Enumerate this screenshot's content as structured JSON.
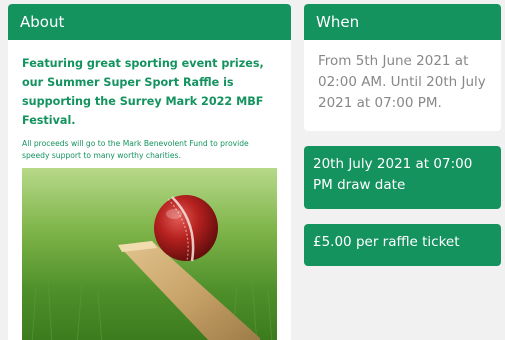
{
  "about": {
    "title": "About",
    "lead": "Featuring great sporting event prizes, our Summer Super Sport Raffle is supporting the Surrey Mark 2022 MBF Festival.",
    "detail": "All proceeds will go to the Mark Benevolent Fund to provide speedy support to many worthy charities.",
    "image_icon": "cricket-ball-and-bat-photo"
  },
  "when": {
    "title": "When",
    "text": "From 5th June 2021 at 02:00 AM. Until 20th July 2021 at 07:00 PM."
  },
  "draw": {
    "text": "20th July 2021 at 07:00 PM draw date"
  },
  "ticket": {
    "text": "£5.00 per raffle ticket"
  },
  "colors": {
    "accent": "#14935f",
    "background": "#f1f1f1",
    "muted_text": "#888888"
  }
}
